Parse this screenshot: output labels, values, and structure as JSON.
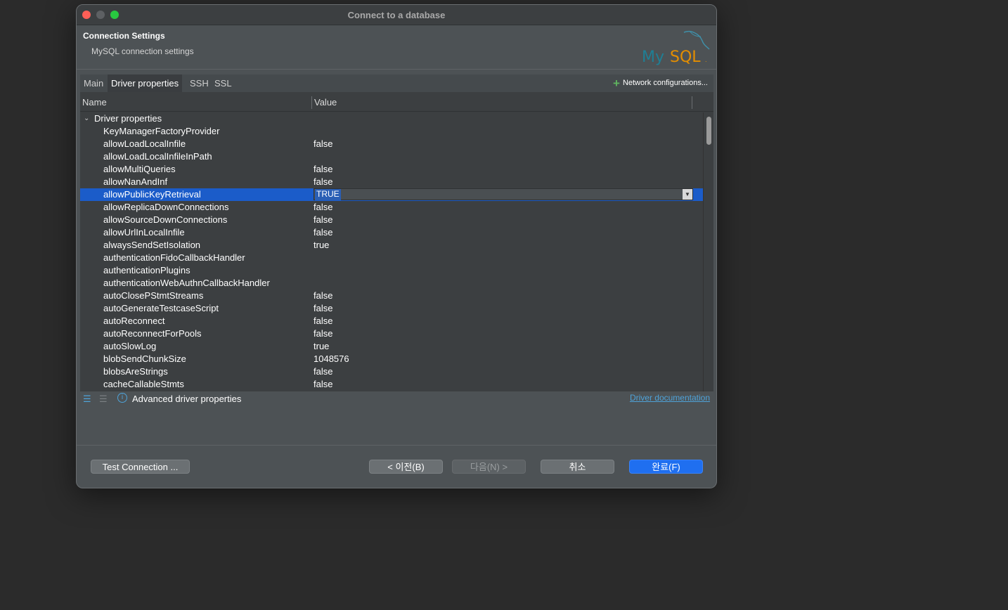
{
  "window": {
    "title": "Connect to a database"
  },
  "header": {
    "title": "Connection Settings",
    "subtitle": "MySQL connection settings",
    "logo_text": "MySQL"
  },
  "tabs": [
    {
      "label": "Main"
    },
    {
      "label": "Driver properties"
    },
    {
      "label": "SSH"
    },
    {
      "label": "SSL"
    }
  ],
  "network_config_label": "Network configurations...",
  "table": {
    "columns": [
      "Name",
      "Value"
    ],
    "group_label": "Driver properties",
    "rows": [
      {
        "name": "KeyManagerFactoryProvider",
        "value": ""
      },
      {
        "name": "allowLoadLocalInfile",
        "value": "false"
      },
      {
        "name": "allowLoadLocalInfileInPath",
        "value": ""
      },
      {
        "name": "allowMultiQueries",
        "value": "false"
      },
      {
        "name": "allowNanAndInf",
        "value": "false"
      },
      {
        "name": "allowPublicKeyRetrieval",
        "value": "TRUE"
      },
      {
        "name": "allowReplicaDownConnections",
        "value": "false"
      },
      {
        "name": "allowSourceDownConnections",
        "value": "false"
      },
      {
        "name": "allowUrlInLocalInfile",
        "value": "false"
      },
      {
        "name": "alwaysSendSetIsolation",
        "value": "true"
      },
      {
        "name": "authenticationFidoCallbackHandler",
        "value": ""
      },
      {
        "name": "authenticationPlugins",
        "value": ""
      },
      {
        "name": "authenticationWebAuthnCallbackHandler",
        "value": ""
      },
      {
        "name": "autoClosePStmtStreams",
        "value": "false"
      },
      {
        "name": "autoGenerateTestcaseScript",
        "value": "false"
      },
      {
        "name": "autoReconnect",
        "value": "false"
      },
      {
        "name": "autoReconnectForPools",
        "value": "false"
      },
      {
        "name": "autoSlowLog",
        "value": "true"
      },
      {
        "name": "blobSendChunkSize",
        "value": "1048576"
      },
      {
        "name": "blobsAreStrings",
        "value": "false"
      },
      {
        "name": "cacheCallableStmts",
        "value": "false"
      }
    ]
  },
  "footer": {
    "advanced_label": "Advanced driver properties",
    "doc_link": "Driver documentation"
  },
  "buttons": {
    "test": "Test Connection ...",
    "back": "< 이전(B)",
    "next": "다음(N) >",
    "cancel": "취소",
    "finish": "완료(F)"
  }
}
